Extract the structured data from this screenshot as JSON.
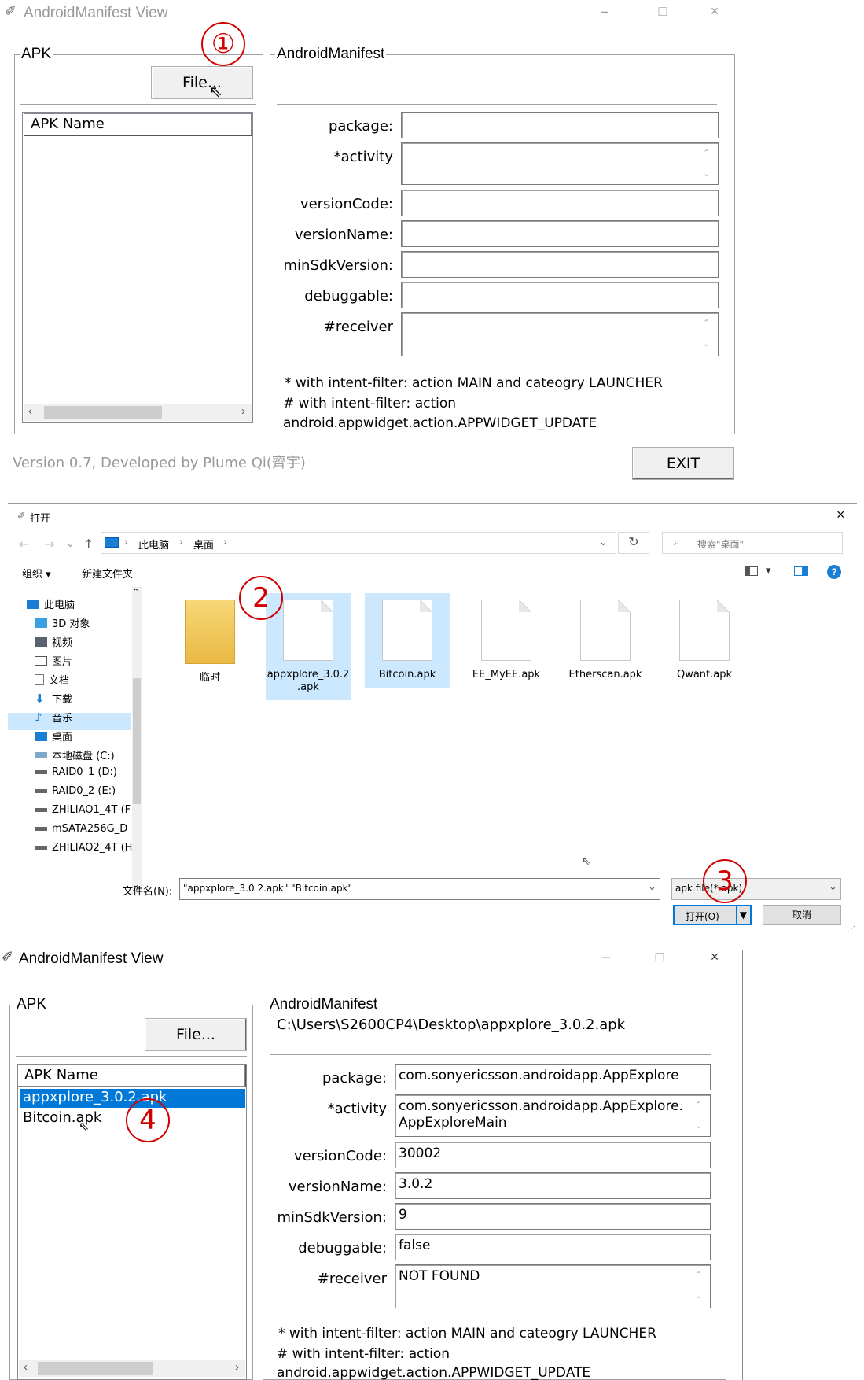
{
  "top_window": {
    "title": "AndroidManifest View",
    "controls": [
      "–",
      "□",
      "×"
    ],
    "apk_group": "APK",
    "file_button": "File...",
    "apk_list_header": "APK Name",
    "manifest_group": "AndroidManifest",
    "fields": [
      {
        "label": "package:",
        "value": ""
      },
      {
        "label": "*activity",
        "value": ""
      },
      {
        "label": "versionCode:",
        "value": ""
      },
      {
        "label": "versionName:",
        "value": ""
      },
      {
        "label": "minSdkVersion:",
        "value": ""
      },
      {
        "label": "debuggable:",
        "value": ""
      },
      {
        "label": "#receiver",
        "value": ""
      }
    ],
    "note1": "* with intent-filter: action MAIN and cateogry  LAUNCHER",
    "note2": "# with intent-filter: action",
    "note3": "android.appwidget.action.APPWIDGET_UPDATE",
    "version": "Version 0.7, Developed by Plume Qi(齊宇)",
    "exit_button": "EXIT"
  },
  "dialog": {
    "title": "打开",
    "close": "×",
    "breadcrumb": [
      "此电脑",
      "桌面"
    ],
    "search_placeholder": "搜索\"桌面\"",
    "organize": "组织 ▾",
    "new_folder": "新建文件夹",
    "nav_items": [
      {
        "label": "此电脑",
        "icon": "computer-icon"
      },
      {
        "label": "3D 对象",
        "icon": "cube-icon"
      },
      {
        "label": "视频",
        "icon": "video-icon"
      },
      {
        "label": "图片",
        "icon": "picture-icon"
      },
      {
        "label": "文档",
        "icon": "document-icon"
      },
      {
        "label": "下载",
        "icon": "download-icon"
      },
      {
        "label": "音乐",
        "icon": "music-icon"
      },
      {
        "label": "桌面",
        "icon": "desktop-icon"
      },
      {
        "label": "本地磁盘 (C:)",
        "icon": "disk-icon"
      },
      {
        "label": "RAID0_1 (D:)",
        "icon": "drive-icon"
      },
      {
        "label": "RAID0_2 (E:)",
        "icon": "drive-icon"
      },
      {
        "label": "ZHILIAO1_4T (F",
        "icon": "drive-icon"
      },
      {
        "label": "mSATA256G_D",
        "icon": "drive-icon"
      },
      {
        "label": "ZHILIAO2_4T (H",
        "icon": "drive-icon"
      }
    ],
    "files": [
      {
        "label": "临时",
        "kind": "folder"
      },
      {
        "label": "appxplore_3.0.2\n.apk",
        "kind": "file"
      },
      {
        "label": "Bitcoin.apk",
        "kind": "file"
      },
      {
        "label": "EE_MyEE.apk",
        "kind": "file"
      },
      {
        "label": "Etherscan.apk",
        "kind": "file"
      },
      {
        "label": "Qwant.apk",
        "kind": "file"
      }
    ],
    "filename_label": "文件名(N):",
    "filename_value": "\"appxplore_3.0.2.apk\" \"Bitcoin.apk\"",
    "filetype_value": "apk file(*.apk)",
    "open_button": "打开(O)",
    "cancel_button": "取消"
  },
  "bottom_window": {
    "title": "AndroidManifest View",
    "controls": [
      "–",
      "□",
      "×"
    ],
    "apk_group": "APK",
    "file_button": "File...",
    "apk_list_header": "APK Name",
    "apk_items": [
      "appxplore_3.0.2.apk",
      "Bitcoin.apk"
    ],
    "manifest_group": "AndroidManifest",
    "path": "C:\\Users\\S2600CP4\\Desktop\\appxplore_3.0.2.apk",
    "fields": [
      {
        "label": "package:",
        "value": "com.sonyericsson.androidapp.AppExplore"
      },
      {
        "label": "*activity",
        "value": "com.sonyericsson.androidapp.AppExplore.\nAppExploreMain"
      },
      {
        "label": "versionCode:",
        "value": "30002"
      },
      {
        "label": "versionName:",
        "value": "3.0.2"
      },
      {
        "label": "minSdkVersion:",
        "value": "9"
      },
      {
        "label": "debuggable:",
        "value": "false"
      },
      {
        "label": "#receiver",
        "value": "NOT FOUND"
      }
    ],
    "note1": "* with intent-filter: action MAIN and cateogry  LAUNCHER",
    "note2": "# with intent-filter: action",
    "note3": "android.appwidget.action.APPWIDGET_UPDATE"
  },
  "step_markers": [
    "①",
    "2",
    "3",
    "4"
  ],
  "colors": {
    "selection": "#0078d7",
    "marker": "#d00000",
    "selected_file": "#cce8ff"
  }
}
